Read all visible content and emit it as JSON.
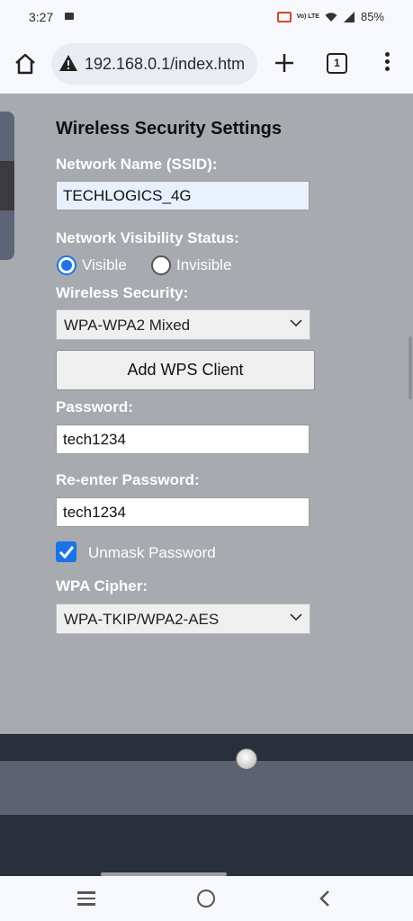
{
  "status_bar": {
    "time": "3:27",
    "battery": "85%",
    "volte_label": "Vo) LTE",
    "icons": [
      "video-recording-icon",
      "cast-icon",
      "volte-icon",
      "wifi-icon",
      "signal-icon"
    ]
  },
  "browser": {
    "url": "192.168.0.1/index.htm",
    "tab_count": "1",
    "icons": [
      "home-icon",
      "warning-icon",
      "plus-icon",
      "menu-icon"
    ]
  },
  "form": {
    "title": "Wireless Security Settings",
    "ssid_label": "Network Name (SSID):",
    "ssid_value": "TECHLOGICS_4G",
    "visibility_label": "Network Visibility Status:",
    "visibility_options": [
      "Visible",
      "Invisible"
    ],
    "visibility_selected": "Visible",
    "security_label": "Wireless Security:",
    "security_value": "WPA-WPA2 Mixed",
    "wps_button": "Add WPS Client",
    "password_label": "Password:",
    "password_value": "tech1234",
    "reenter_label": "Re-enter Password:",
    "reenter_value": "tech1234",
    "unmask_label": "Unmask Password",
    "unmask_checked": true,
    "cipher_label": "WPA Cipher:",
    "cipher_value": "WPA-TKIP/WPA2-AES"
  },
  "colors": {
    "page_bg": "#a7aaaf",
    "accent": "#1a73e8",
    "footer_dark": "#2a2f3c",
    "footer_band": "#5d6272"
  }
}
